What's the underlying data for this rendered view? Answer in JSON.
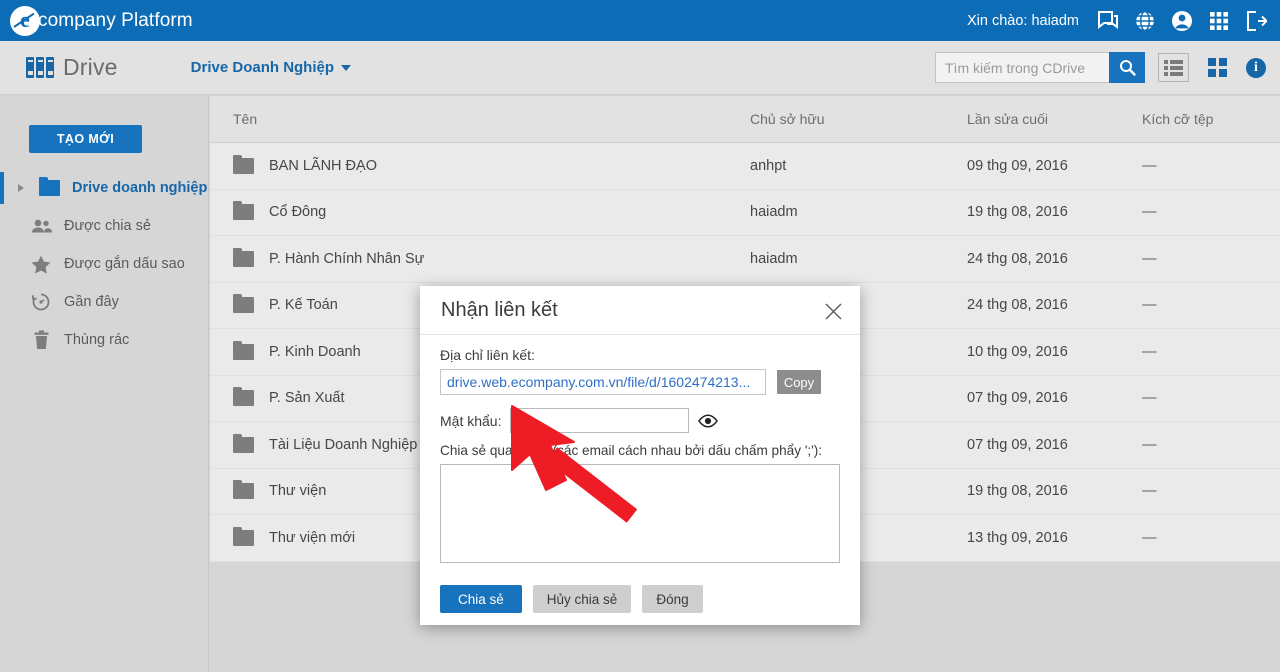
{
  "topbar": {
    "brand_name": "company Platform",
    "logo_letter": "e",
    "greeting": "Xin chào: haiadm",
    "icons": [
      "chat-icon",
      "globe-icon",
      "account-icon",
      "apps-grid-icon",
      "logout-icon"
    ]
  },
  "subbar": {
    "app_name": "Drive",
    "breadcrumb": "Drive Doanh Nghiệp",
    "search_placeholder": "Tìm kiếm trong CDrive",
    "search_value": "",
    "view_list": "list-view-icon",
    "view_grid": "grid-view-icon",
    "info": "i"
  },
  "sidebar": {
    "new_button": "TẠO MỚI",
    "items": [
      {
        "label": "Drive doanh nghiệp",
        "icon": "folder-icon",
        "active": true
      },
      {
        "label": "Được chia sẻ",
        "icon": "people-icon",
        "active": false
      },
      {
        "label": "Được gắn dấu sao",
        "icon": "star-icon",
        "active": false
      },
      {
        "label": "Gần đây",
        "icon": "recent-clock-icon",
        "active": false
      },
      {
        "label": "Thùng rác",
        "icon": "trash-icon",
        "active": false
      }
    ]
  },
  "table": {
    "headers": {
      "name": "Tên",
      "owner": "Chủ sở hữu",
      "modified": "Lần sửa cuối",
      "size": "Kích cỡ tệp"
    },
    "rows": [
      {
        "name": "BAN LÃNH ĐẠO",
        "owner": "anhpt",
        "modified": "09 thg 09, 2016",
        "size": "—"
      },
      {
        "name": "Cổ Đông",
        "owner": "haiadm",
        "modified": "19 thg 08, 2016",
        "size": "—"
      },
      {
        "name": "P. Hành Chính Nhân Sự",
        "owner": "haiadm",
        "modified": "24 thg 08, 2016",
        "size": "—"
      },
      {
        "name": "P. Kế Toán",
        "owner": "",
        "modified": "24 thg 08, 2016",
        "size": "—"
      },
      {
        "name": "P. Kinh Doanh",
        "owner": "",
        "modified": "10 thg 09, 2016",
        "size": "—"
      },
      {
        "name": "P. Sản Xuất",
        "owner": "",
        "modified": "07 thg 09, 2016",
        "size": "—"
      },
      {
        "name": "Tài Liệu Doanh Nghiệp",
        "owner": "",
        "modified": "07 thg 09, 2016",
        "size": "—"
      },
      {
        "name": "Thư viện",
        "owner": "",
        "modified": "19 thg 08, 2016",
        "size": "—"
      },
      {
        "name": "Thư viện mới",
        "owner": "",
        "modified": "13 thg 09, 2016",
        "size": "—"
      }
    ]
  },
  "dialog": {
    "title": "Nhận liên kết",
    "close": "×",
    "link_label": "Địa chỉ liên kết:",
    "link_value": "drive.web.ecompany.com.vn/file/d/1602474213...",
    "copy_button": "Copy",
    "password_label": "Mật khẩu:",
    "password_value": "",
    "toggle_password_icon": "eye-icon",
    "email_label": "Chia sẻ qua email (các email cách nhau bởi dấu chấm phẩy ';'):",
    "email_value": "",
    "share_button": "Chia sẻ",
    "unshare_button": "Hủy chia sẻ",
    "close_button": "Đóng"
  },
  "colors": {
    "brand_blue": "#0c6cb5",
    "accent_blue": "#1773bd",
    "link_blue": "#2f6fc4",
    "cursor_red": "#ee1c25",
    "page_bg": "#d6d6d6"
  }
}
